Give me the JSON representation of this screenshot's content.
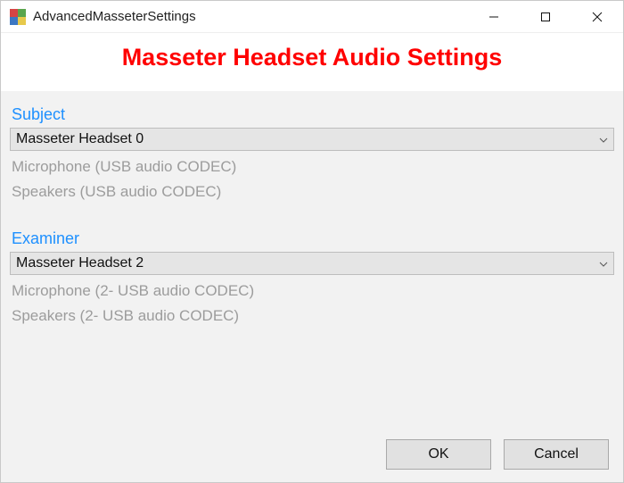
{
  "window": {
    "title": "AdvancedMasseterSettings"
  },
  "heading": "Masseter Headset Audio Settings",
  "subject": {
    "label": "Subject",
    "selected": "Masseter Headset 0",
    "mic_line": "Microphone (USB audio CODEC)",
    "spk_line": "Speakers (USB audio CODEC)"
  },
  "examiner": {
    "label": "Examiner",
    "selected": "Masseter Headset 2",
    "mic_line": "Microphone (2- USB audio CODEC)",
    "spk_line": "Speakers (2- USB audio CODEC)"
  },
  "buttons": {
    "ok": "OK",
    "cancel": "Cancel"
  }
}
